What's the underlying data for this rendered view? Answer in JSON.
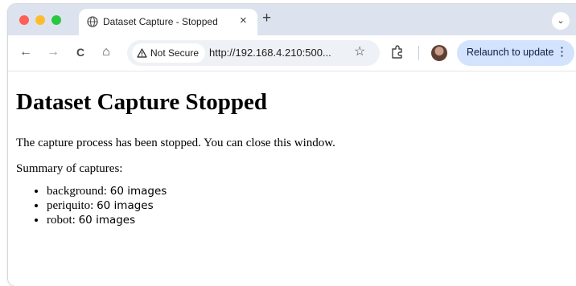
{
  "browser": {
    "tab": {
      "title": "Dataset Capture - Stopped",
      "close_glyph": "×"
    },
    "new_tab_glyph": "+",
    "tab_menu_glyph": "⌄",
    "toolbar": {
      "back_glyph": "←",
      "forward_glyph": "→",
      "reload_glyph": "C",
      "home_glyph": "⌂"
    },
    "omnibox": {
      "security_label": "Not Secure",
      "url": "http://192.168.4.210:500...",
      "star_glyph": "☆"
    },
    "relaunch": {
      "label": "Relaunch to update",
      "menu_glyph": "⋮"
    }
  },
  "page": {
    "heading": "Dataset Capture Stopped",
    "message": "The capture process has been stopped. You can close this window.",
    "summary_label": "Summary of captures:",
    "captures": [
      {
        "label": "background:",
        "count": "60 images"
      },
      {
        "label": "periquito:",
        "count": "60 images"
      },
      {
        "label": "robot:",
        "count": "60 images"
      }
    ]
  },
  "colors": {
    "tabstrip": "#dde3ee",
    "omnibox": "#eef1f6",
    "relaunch_bg": "#d3e3fd",
    "close": "#fe5f57",
    "minimize": "#febc2e",
    "zoom": "#28c840"
  }
}
